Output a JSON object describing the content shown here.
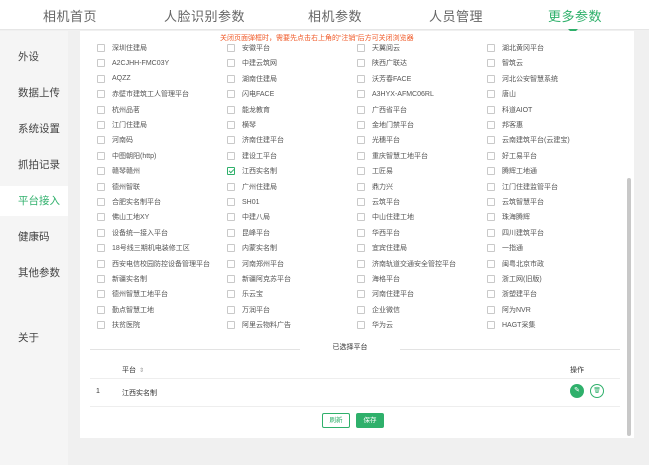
{
  "topnav": {
    "tabs": [
      {
        "label": "相机首页"
      },
      {
        "label": "人脸识别参数"
      },
      {
        "label": "相机参数"
      },
      {
        "label": "人员管理"
      },
      {
        "label": "更多参数"
      }
    ]
  },
  "sidebar": {
    "items": [
      {
        "label": "外设"
      },
      {
        "label": "数据上传"
      },
      {
        "label": "系统设置"
      },
      {
        "label": "抓拍记录"
      },
      {
        "label": "平台接入"
      },
      {
        "label": "健康码"
      },
      {
        "label": "其他参数"
      },
      {
        "label": "关于"
      }
    ]
  },
  "notice": "关闭页面弹框时，需要先点击右上角的“注销”后方可关闭浏览器",
  "platforms": [
    [
      "深圳住建局",
      "安徽平台",
      "天翼阅云",
      "湖北黄冈平台"
    ],
    [
      "A2CJHH-FMC03Y",
      "中建云筑网",
      "陕西广联达",
      "智筑云"
    ],
    [
      "AQZZ",
      "湖南住建局",
      "沃芳春FACE",
      "河北公安智慧系统"
    ],
    [
      "赤壁市建筑工人管理平台",
      "闪电FACE",
      "A3HYX-AFMC06RL",
      "唐山"
    ],
    [
      "杭州品茗",
      "能龙教育",
      "广西省平台",
      "科道AIOT"
    ],
    [
      "江门住建局",
      "横琴",
      "金地门禁平台",
      "邦客惠"
    ],
    [
      "河南码",
      "济南住建平台",
      "光穗平台",
      "云南建筑平台(云建宝)"
    ],
    [
      "中图朝阳(http)",
      "建设工平台",
      "重庆智慧工地平台",
      "好工易平台"
    ],
    [
      "赣琴赣州",
      "江西实名制",
      "工匠易",
      "腾辉工地通"
    ],
    [
      "德州智联",
      "广州住建局",
      "鼎力兴",
      "江门住建监管平台"
    ],
    [
      "合肥实名制平台",
      "SH01",
      "云筑平台",
      "云筑智慧平台"
    ],
    [
      "佛山工地XY",
      "中建八局",
      "中山住建工地",
      "珠海腾辉"
    ],
    [
      "设备统一接入平台",
      "昆峰平台",
      "华西平台",
      "四川建筑平台"
    ],
    [
      "18号线三期机电装修工区",
      "内蒙实名制",
      "宜宾住建局",
      "一指通"
    ],
    [
      "西安电信校园防控设备管理平台",
      "河南郑州平台",
      "济南轨道交通安全管控平台",
      "闽粤北京市政"
    ],
    [
      "新疆实名制",
      "新疆阿克苏平台",
      "海格平台",
      "浙工网(旧版)"
    ],
    [
      "德州智慧工地平台",
      "乐云宝",
      "河南住建平台",
      "浙塑建平台"
    ],
    [
      "勤点智慧工地",
      "万润平台",
      "企业微信",
      "阿为NVR"
    ],
    [
      "扶贫医院",
      "阿里云物料广告",
      "华为云",
      "HAGT采集"
    ]
  ],
  "checked_platform": "江西实名制",
  "selected_section": {
    "title": "已选择平台",
    "col_platform": "平台",
    "col_action": "操作",
    "rows": [
      {
        "index": "1",
        "platform": "江西实名制"
      }
    ]
  },
  "buttons": {
    "refresh": "刷新",
    "save": "保存"
  },
  "colors": {
    "accent": "#2fb06b",
    "notice": "#f05a28"
  }
}
